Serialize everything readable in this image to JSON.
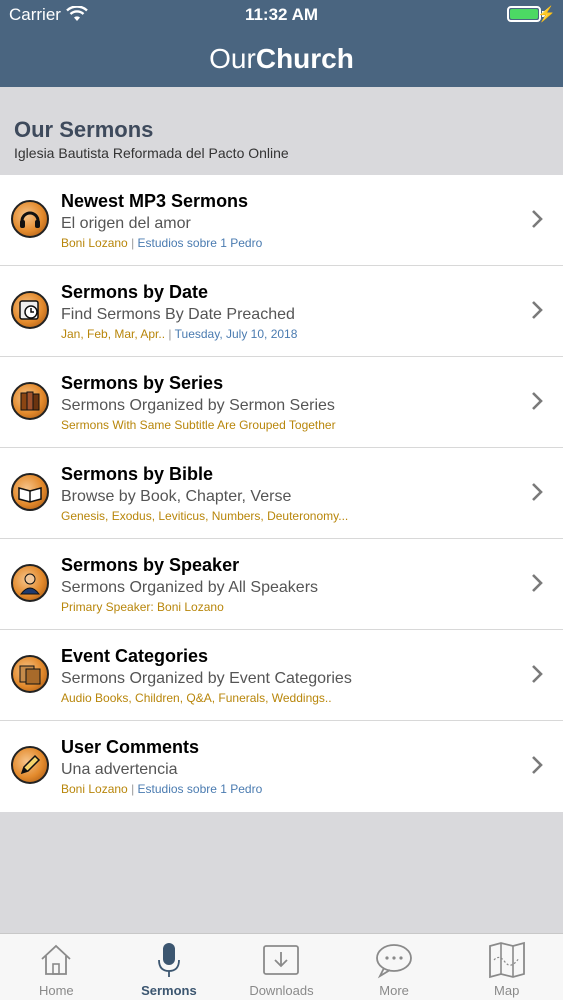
{
  "status_bar": {
    "carrier": "Carrier",
    "time": "11:32 AM",
    "battery_level": 1.0
  },
  "nav": {
    "title_light": "Our",
    "title_bold": "Church"
  },
  "header": {
    "title": "Our Sermons",
    "subtitle": "Iglesia Bautista Reformada del Pacto Online"
  },
  "rows": [
    {
      "title": "Newest MP3 Sermons",
      "subtitle": "El origen del amor",
      "detail_a": "Boni Lozano",
      "detail_sep": " | ",
      "detail_b": "Estudios sobre 1 Pedro",
      "icon": "headphones-icon"
    },
    {
      "title": "Sermons by Date",
      "subtitle": "Find Sermons By Date Preached",
      "detail_a": "Jan, Feb, Mar, Apr..",
      "detail_sep": " | ",
      "detail_b": "Tuesday, July 10, 2018",
      "icon": "calendar-clock-icon"
    },
    {
      "title": "Sermons by Series",
      "subtitle": "Sermons Organized by Sermon Series",
      "detail_a": "Sermons With Same Subtitle Are Grouped Together",
      "icon": "books-icon"
    },
    {
      "title": "Sermons by Bible",
      "subtitle": "Browse by Book, Chapter, Verse",
      "detail_a": "Genesis, Exodus, Leviticus, Numbers, Deuteronomy...",
      "icon": "open-bible-icon"
    },
    {
      "title": "Sermons by Speaker",
      "subtitle": "Sermons Organized by All Speakers",
      "detail_a": "Primary Speaker: Boni Lozano",
      "icon": "speaker-person-icon"
    },
    {
      "title": "Event Categories",
      "subtitle": "Sermons Organized by Event Categories",
      "detail_a": "Audio Books, Children, Q&A, Funerals, Weddings..",
      "icon": "folders-icon"
    },
    {
      "title": "User Comments",
      "subtitle": "Una advertencia",
      "detail_a": "Boni Lozano",
      "detail_sep": " | ",
      "detail_b": "Estudios sobre 1 Pedro",
      "icon": "pencil-icon"
    }
  ],
  "tabs": [
    {
      "label": "Home",
      "icon": "home-icon",
      "active": false
    },
    {
      "label": "Sermons",
      "icon": "microphone-icon",
      "active": true
    },
    {
      "label": "Downloads",
      "icon": "download-icon",
      "active": false
    },
    {
      "label": "More",
      "icon": "chat-bubble-icon",
      "active": false
    },
    {
      "label": "Map",
      "icon": "map-icon",
      "active": false
    }
  ],
  "colors": {
    "nav_bg": "#4a6580",
    "detail_gold": "#b8860b",
    "detail_blue": "#4a7bb0",
    "tab_active": "#3c5670"
  }
}
